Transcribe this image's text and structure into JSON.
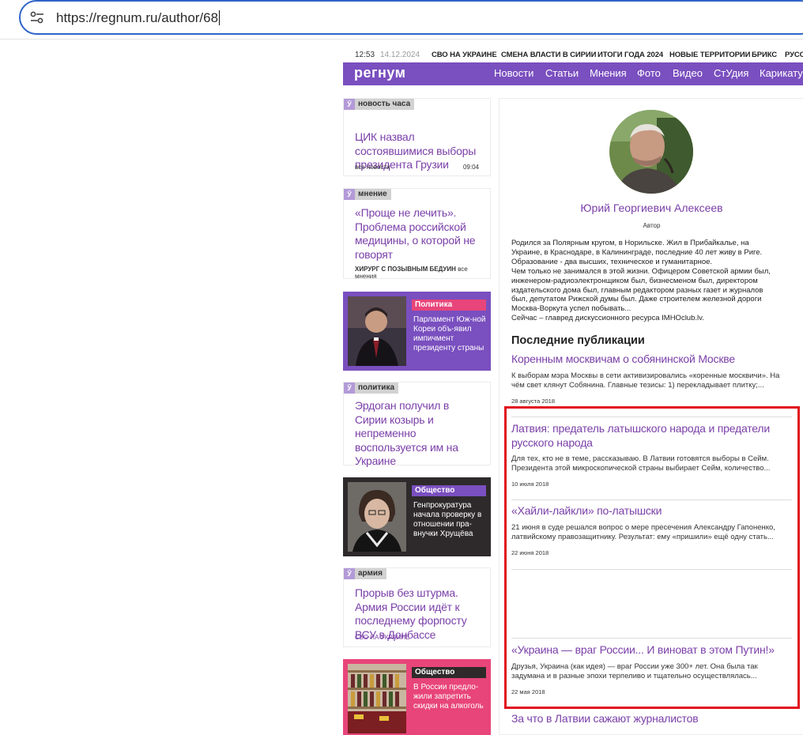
{
  "browser": {
    "url": "https://regnum.ru/author/68"
  },
  "topstrip": {
    "time": "12:53",
    "date": "14.12.2024",
    "links": [
      "СВО НА УКРАИНЕ",
      "СМЕНА ВЛАСТИ В СИРИИ",
      "ИТОГИ ГОДА 2024",
      "НОВЫЕ ТЕРРИТОРИИ",
      "БРИКС",
      "РУСС"
    ]
  },
  "header": {
    "logo": "регнум",
    "nav": [
      "Новости",
      "Статьи",
      "Мнения",
      "Фото",
      "Видео",
      "СтУдия",
      "Карикату"
    ]
  },
  "sidebar": {
    "card1": {
      "rubric": "новость часа",
      "title": "ЦИК назвал состоявшимися выборы президента Грузии",
      "foot_left": "все новости",
      "foot_right": "09:04"
    },
    "card2": {
      "rubric": "мнение",
      "title": "«Проще не лечить». Проблема российской медицины, о которой не говорят",
      "foot_author": "ХИРУРГ С ПОЗЫВНЫМ БЕДУИН",
      "foot_more": "все мнения"
    },
    "img1": {
      "category": "Политика",
      "text": "Парламент Юж-ной Кореи объ-явил импичмент президенту страны",
      "bg": "#7a4fbf",
      "cat_bg": "#e8457a"
    },
    "card3": {
      "rubric": "политика",
      "title": "Эрдоган получил в Сирии козырь и непременно воспользуется им на Украине"
    },
    "img2": {
      "category": "Общество",
      "text": "Генпрокуратура начала проверку в отношении пра-внучки Хрущёва",
      "bg": "#2e2a2b",
      "cat_bg": "#7a4fbf"
    },
    "card4": {
      "rubric": "армия",
      "title": "Прорыв без штурма. Армия России идёт к последнему форпосту ВСУ в Донбассе",
      "foot_tag": "СВО НА УКРАИНЕ"
    },
    "img3": {
      "category": "Общество",
      "text": "В России предло-жили запретить скидки на алкоголь",
      "bg": "#e8457a",
      "cat_bg": "#2e2a2b"
    }
  },
  "author": {
    "name": "Юрий Георгиевич Алексеев",
    "role": "Автор",
    "bio": [
      "Родился за Полярным кругом, в Норильске. Жил в Прибайкалье, на",
      "Украине, в Краснодаре, в Калининграде, последние 40 лет живу в Риге.",
      "Образование - два высших, техническое и гуманитарное.",
      "Чем только не занимался в этой жизни. Офицером Советской армии был,",
      "инженером-радиоэлектронщиком был, бизнесменом был, директором",
      "издательского дома был, главным редактором разных газет и журналов",
      "был, депутатом Рижской думы был. Даже строителем железной дороги",
      "Москва-Воркута успел побывать...",
      "Сейчас – главред дискуссионного ресурса IMHOclub.lv."
    ],
    "publications_title": "Последние публикации",
    "publications": [
      {
        "title": "Коренным москвичам о собянинской Москве",
        "excerpt": "К выборам мэра Москвы в сети активизировались «коренные москвичи». На чём свет клянут Собянина. Главные тезисы: 1) перекладывает плитку;...",
        "date": "28 августа 2018"
      },
      {
        "title": "Латвия: предатель латышского народа и предатели русского народа",
        "excerpt": "Для тех, кто не в теме, рассказываю. В Латвии готовятся выборы в Сейм. Президента этой микроскопической страны выбирает Сейм, количество...",
        "date": "10 июля 2018"
      },
      {
        "title": "«Хайли-лайкли» по-латышски",
        "excerpt": "21 июня в суде решался вопрос о мере пресечения Александру Гапоненко, латвийскому правозащитнику. Результат: ему «пришили» ещё одну стать...",
        "date": "22 июня 2018"
      },
      {
        "title": "«Украина — враг России... И виноват в этом Путин!»",
        "excerpt": "Друзья, Украина (как идея) — враг России уже 300+ лет. Она была так задумана и в разные эпохи терпеливо и тщательно осуществлялась...",
        "date": "22 мая 2018"
      },
      {
        "title": "За что в Латвии сажают журналистов"
      }
    ]
  },
  "colors": {
    "brand": "#7a4fbf",
    "link": "#7a3fa8",
    "highlight": "#e0121e",
    "url_focus": "#2f63c9"
  }
}
